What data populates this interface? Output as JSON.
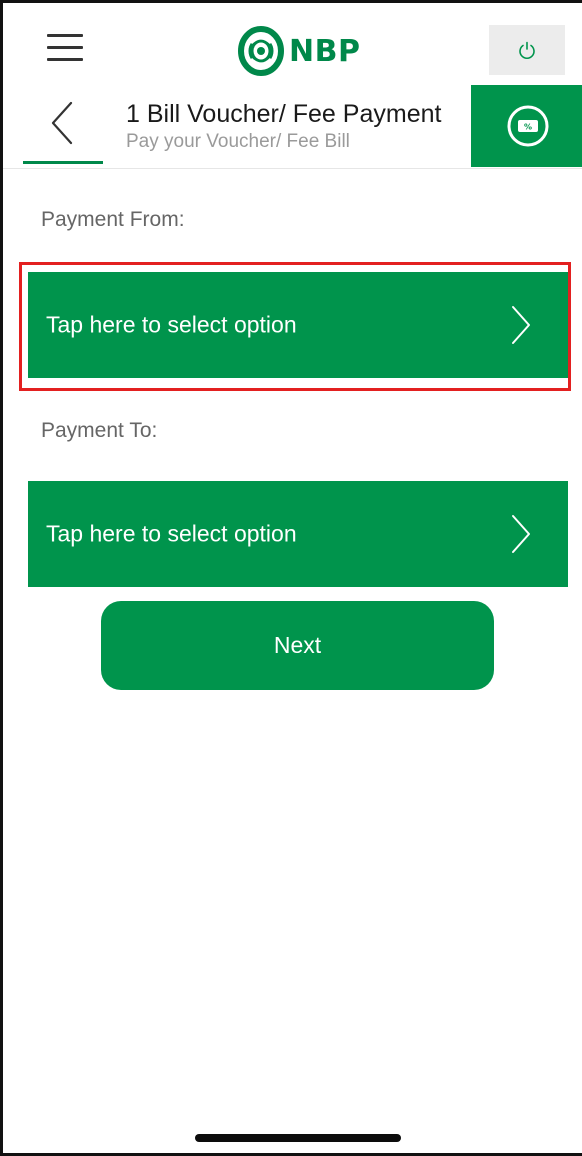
{
  "top_bar": {
    "logo_text": "NBP",
    "menu_icon": "hamburger-menu-icon",
    "power_icon": "power-icon"
  },
  "header": {
    "title": "1 Bill Voucher/ Fee Payment",
    "subtitle": "Pay your Voucher/ Fee Bill",
    "back_icon": "chevron-left-icon",
    "voucher_icon": "voucher-icon",
    "voucher_icon_label": "%"
  },
  "form": {
    "payment_from_label": "Payment From:",
    "payment_from_placeholder": "Tap here to select option",
    "payment_to_label": "Payment To:",
    "payment_to_placeholder": "Tap here to select option",
    "next_label": "Next"
  },
  "colors": {
    "brand_green": "#00944c",
    "highlight_red": "#e32020"
  }
}
